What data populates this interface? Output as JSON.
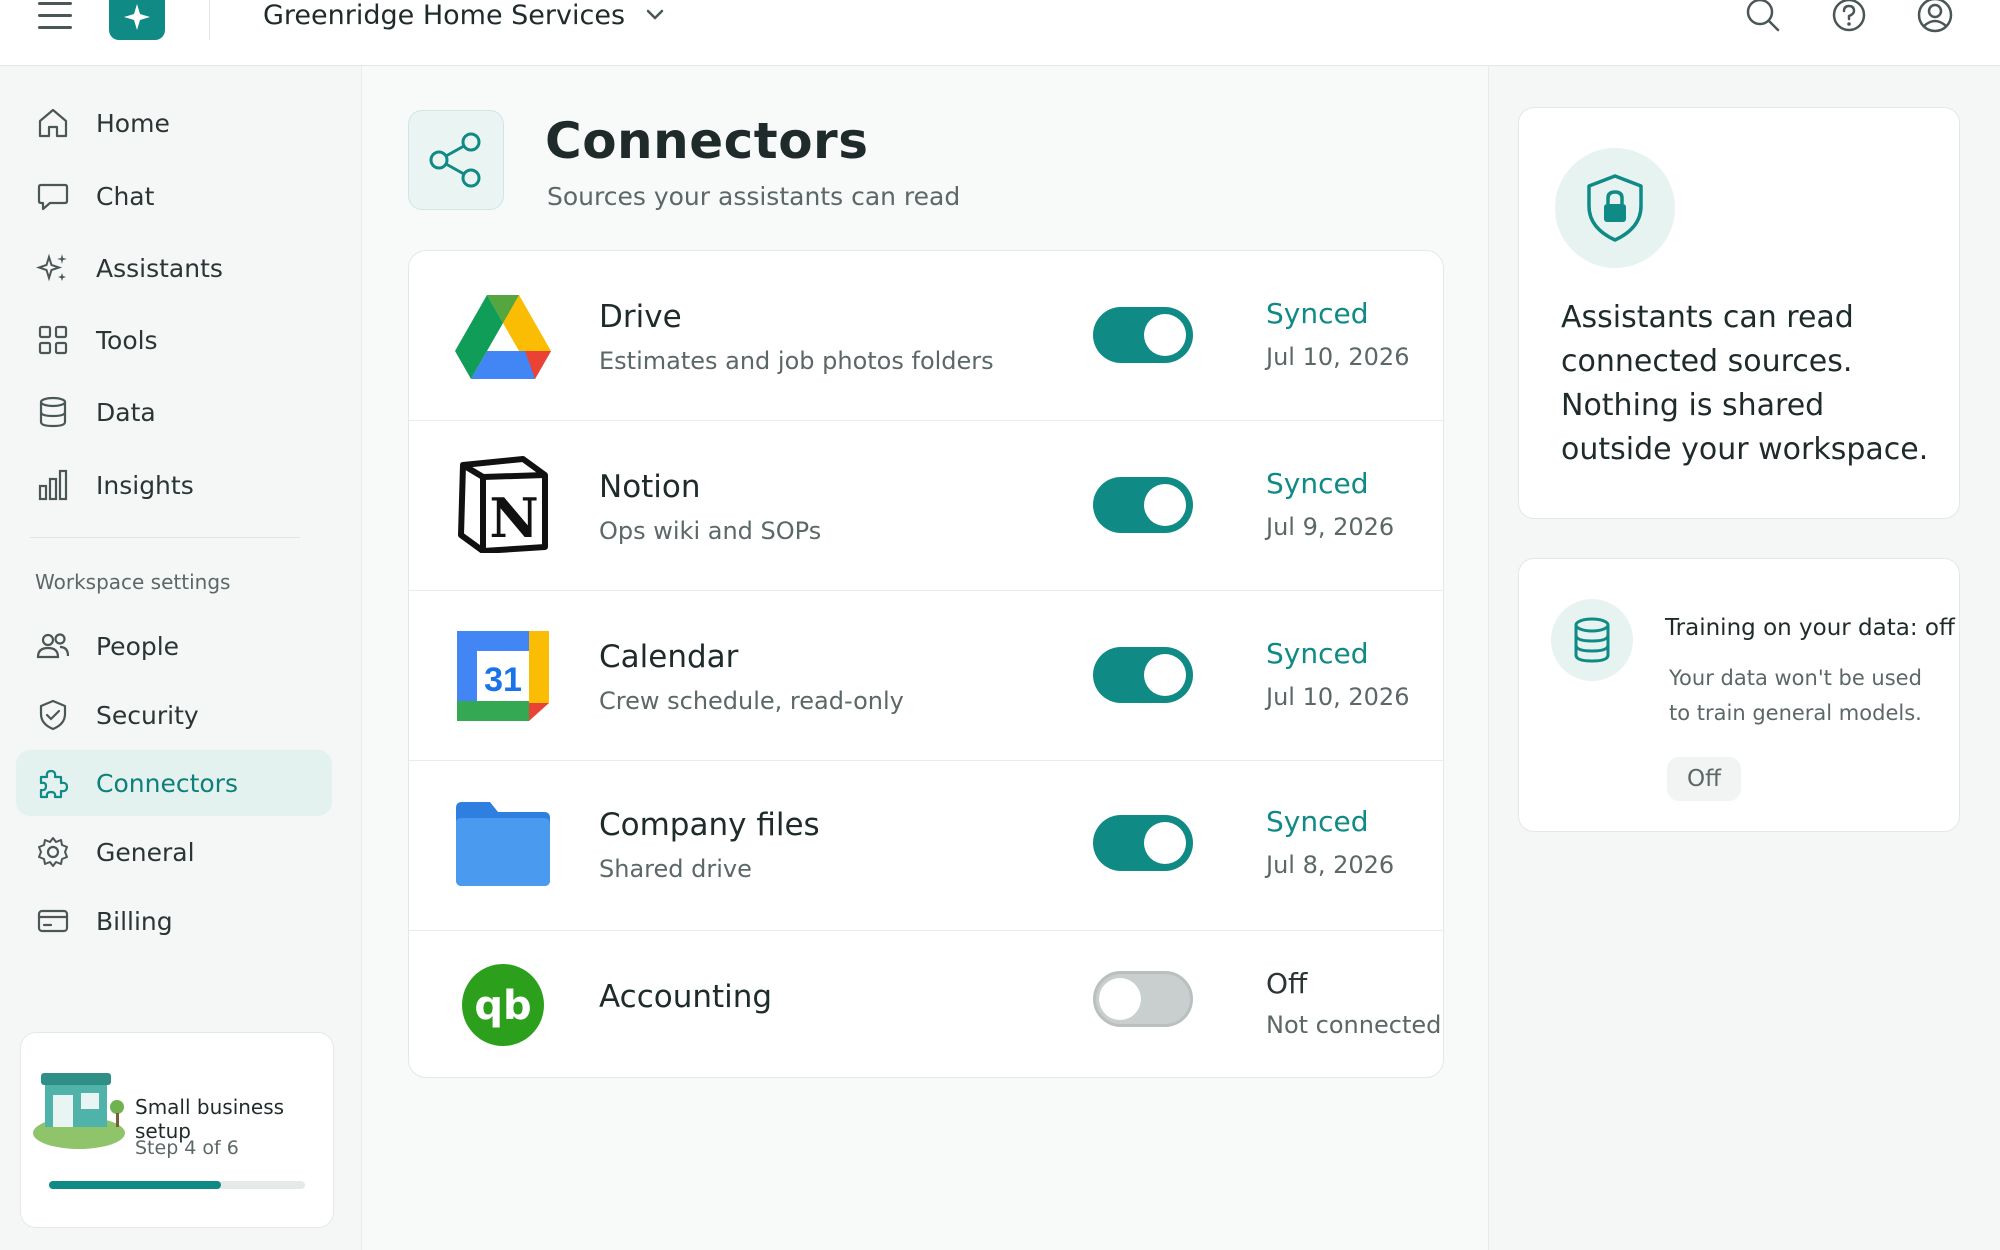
{
  "app": {
    "workspace_name": "Greenridge Home Services",
    "accent_color": "#0f8a84"
  },
  "topbar": {
    "menu_icon": "hamburger-menu-icon",
    "logo_icon": "sparkle-logo-icon",
    "workspace_chevron_icon": "chevron-down-icon",
    "search_icon": "search-icon",
    "help_icon": "help-icon",
    "account_icon": "account-icon"
  },
  "sidebar": {
    "primary": [
      {
        "label": "Home",
        "icon": "home-icon"
      },
      {
        "label": "Chat",
        "icon": "chat-icon"
      },
      {
        "label": "Assistants",
        "icon": "sparkles-icon"
      },
      {
        "label": "Tools",
        "icon": "grid-icon"
      },
      {
        "label": "Data",
        "icon": "database-icon"
      },
      {
        "label": "Insights",
        "icon": "bar-chart-icon"
      }
    ],
    "section_label": "Workspace settings",
    "settings": [
      {
        "label": "People",
        "icon": "people-icon"
      },
      {
        "label": "Security",
        "icon": "shield-check-icon"
      },
      {
        "label": "Connectors",
        "icon": "puzzle-icon",
        "active": true
      },
      {
        "label": "General",
        "icon": "gear-icon"
      },
      {
        "label": "Billing",
        "icon": "card-icon"
      }
    ],
    "setup": {
      "title": "Small business setup",
      "step": "Step 4 of 6",
      "progress": 0.67
    }
  },
  "main": {
    "title": "Connectors",
    "subtitle": "Sources your assistants can read",
    "icon": "share-nodes-icon",
    "connectors": [
      {
        "name": "Drive",
        "description": "Estimates and job photos folders",
        "enabled": true,
        "status": "Synced",
        "date": "Jul 10, 2026",
        "logo": "drive-logo-icon"
      },
      {
        "name": "Notion",
        "description": "Ops wiki and SOPs",
        "enabled": true,
        "status": "Synced",
        "date": "Jul 9, 2026",
        "logo": "notion-logo-icon"
      },
      {
        "name": "Calendar",
        "description": "Crew schedule, read-only",
        "enabled": true,
        "status": "Synced",
        "date": "Jul 10, 2026",
        "logo": "calendar-logo-icon",
        "logo_text": "31"
      },
      {
        "name": "Company files",
        "description": "Shared drive",
        "enabled": true,
        "status": "Synced",
        "date": "Jul 8, 2026",
        "logo": "folder-icon"
      },
      {
        "name": "Accounting",
        "description": "",
        "enabled": false,
        "status": "Off",
        "date": "Not connected",
        "logo": "quickbooks-logo-icon",
        "logo_text": "qb"
      }
    ]
  },
  "right_rail": {
    "info": {
      "icon": "shield-lock-icon",
      "text": "Assistants can read connected sources. Nothing is shared outside your workspace."
    },
    "training": {
      "icon": "database-icon",
      "title": "Training on your data: off",
      "description": "Your data won't be used to train general models.",
      "pill": "Off"
    }
  }
}
